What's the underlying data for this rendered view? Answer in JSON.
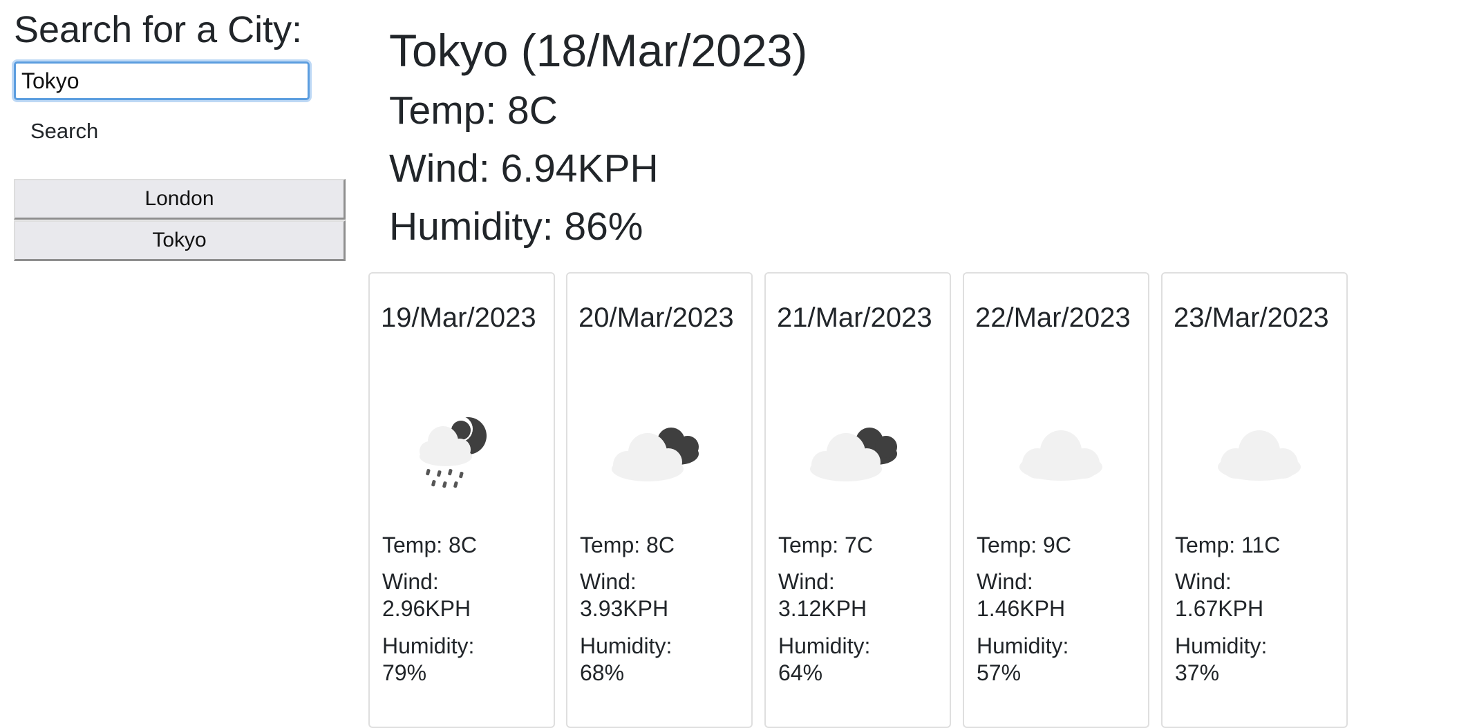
{
  "search": {
    "title": "Search for a City:",
    "input_value": "Tokyo",
    "button_label": "Search"
  },
  "history": [
    {
      "label": "London"
    },
    {
      "label": "Tokyo"
    }
  ],
  "current": {
    "title": "Tokyo (18/Mar/2023)",
    "temp": "Temp: 8C",
    "wind": "Wind: 6.94KPH",
    "humidity": "Humidity: 86%"
  },
  "forecast": [
    {
      "date": "19/Mar/2023",
      "icon": "rain-cloud-night-icon",
      "temp": "Temp: 8C",
      "wind_label": "Wind:",
      "wind": "2.96KPH",
      "humidity_label": "Humidity:",
      "humidity": "79%"
    },
    {
      "date": "20/Mar/2023",
      "icon": "cloud-dark-cloud-icon",
      "temp": "Temp: 8C",
      "wind_label": "Wind:",
      "wind": "3.93KPH",
      "humidity_label": "Humidity:",
      "humidity": "68%"
    },
    {
      "date": "21/Mar/2023",
      "icon": "cloud-dark-cloud-icon",
      "temp": "Temp: 7C",
      "wind_label": "Wind:",
      "wind": "3.12KPH",
      "humidity_label": "Humidity:",
      "humidity": "64%"
    },
    {
      "date": "22/Mar/2023",
      "icon": "cloud-icon",
      "temp": "Temp: 9C",
      "wind_label": "Wind:",
      "wind": "1.46KPH",
      "humidity_label": "Humidity:",
      "humidity": "57%"
    },
    {
      "date": "23/Mar/2023",
      "icon": "cloud-icon",
      "temp": "Temp: 11C",
      "wind_label": "Wind:",
      "wind": "1.67KPH",
      "humidity_label": "Humidity:",
      "humidity": "37%"
    }
  ],
  "colors": {
    "input_focus_border": "#5b9ddf",
    "history_button_bg": "#e9e9ed",
    "card_border": "#dfdfdf",
    "icon_light_cloud": "#f1f1f1",
    "icon_dark_cloud": "#3f3f3f"
  }
}
